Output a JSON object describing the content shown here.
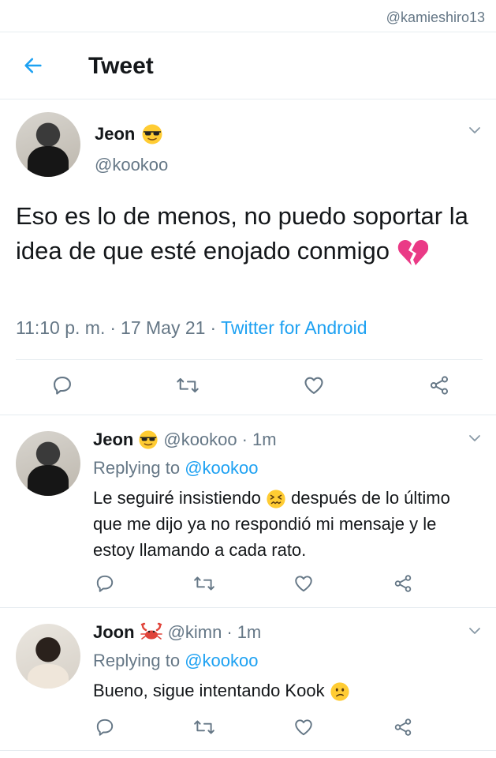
{
  "watermark": "@kamieshiro13",
  "header": {
    "title": "Tweet"
  },
  "main_tweet": {
    "name": "Jeon",
    "name_emoji": "sunglasses-emoji",
    "handle": "@kookoo",
    "text": "Eso es lo de menos, no puedo soportar la idea de que esté enojado conmigo",
    "text_emoji": "broken-heart-emoji",
    "time": "11:10 p. m.",
    "sep1": "·",
    "date": "17 May 21",
    "sep2": "·",
    "client": "Twitter for Android"
  },
  "replies": [
    {
      "name": "Jeon",
      "name_emoji": "sunglasses-emoji",
      "handle": "@kookoo",
      "sep": "·",
      "time": "1m",
      "replying_prefix": "Replying to",
      "replying_to": "@kookoo",
      "text_a": "Le seguiré insistiendo",
      "text_emoji": "confounded-face-emoji",
      "text_b": "después de lo último que me dijo ya no respondió mi mensaje y le estoy llamando a cada rato."
    },
    {
      "name": "Joon",
      "name_emoji": "crab-emoji",
      "handle": "@kimn",
      "sep": "·",
      "time": "1m",
      "replying_prefix": "Replying to",
      "replying_to": "@kookoo",
      "text_a": "Bueno, sigue intentando Kook",
      "text_emoji": "confused-face-emoji"
    }
  ],
  "colors": {
    "accent": "#1da1f2",
    "secondary": "#657786",
    "text": "#14171a",
    "divider": "#e6ecf0"
  }
}
